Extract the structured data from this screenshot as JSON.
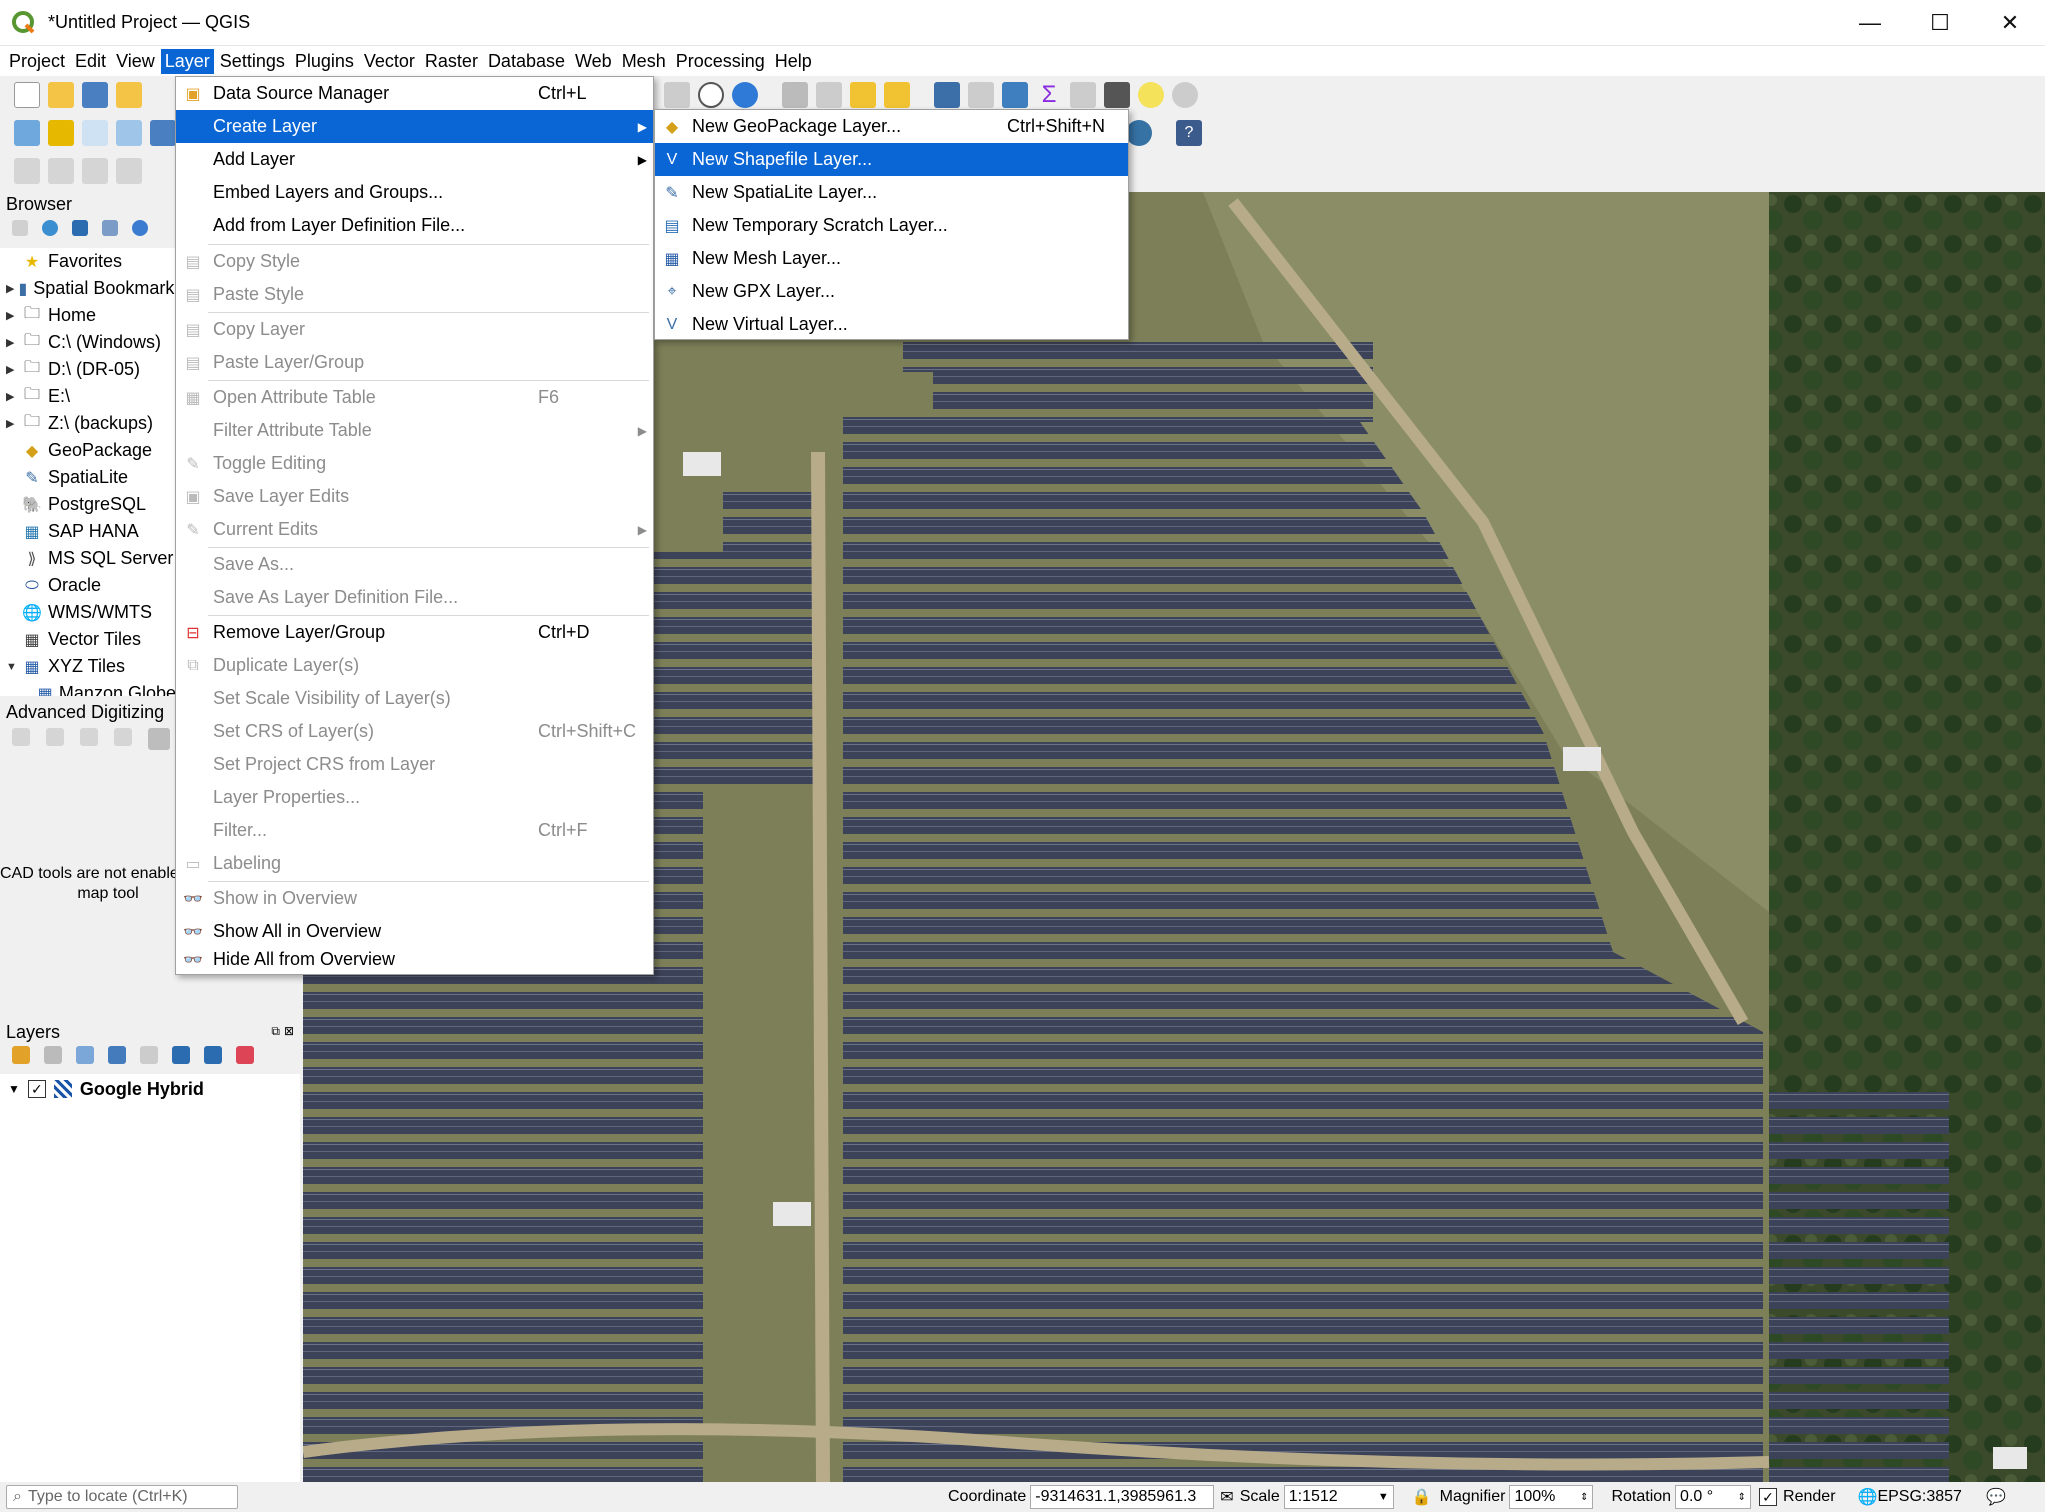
{
  "window": {
    "title": "*Untitled Project — QGIS",
    "minimize": "—",
    "maximize": "☐",
    "close": "✕"
  },
  "menubar": [
    {
      "label": "Project"
    },
    {
      "label": "Edit"
    },
    {
      "label": "View"
    },
    {
      "label": "Layer"
    },
    {
      "label": "Settings"
    },
    {
      "label": "Plugins"
    },
    {
      "label": "Vector"
    },
    {
      "label": "Raster"
    },
    {
      "label": "Database"
    },
    {
      "label": "Web"
    },
    {
      "label": "Mesh"
    },
    {
      "label": "Processing"
    },
    {
      "label": "Help"
    }
  ],
  "browser": {
    "title": "Browser",
    "items": [
      {
        "label": "Favorites",
        "icon": "star-icon"
      },
      {
        "label": "Spatial Bookmarks",
        "icon": "bookmark-icon"
      },
      {
        "label": "Home",
        "icon": "folder-icon"
      },
      {
        "label": "C:\\ (Windows)",
        "icon": "folder-icon"
      },
      {
        "label": "D:\\ (DR-05)",
        "icon": "folder-icon"
      },
      {
        "label": "E:\\",
        "icon": "folder-icon"
      },
      {
        "label": "Z:\\ (backups)",
        "icon": "folder-icon"
      },
      {
        "label": "GeoPackage",
        "icon": "geopackage-icon"
      },
      {
        "label": "SpatiaLite",
        "icon": "spatialite-icon"
      },
      {
        "label": "PostgreSQL",
        "icon": "postgresql-icon"
      },
      {
        "label": "SAP HANA",
        "icon": "sap-hana-icon"
      },
      {
        "label": "MS SQL Server",
        "icon": "mssql-icon"
      },
      {
        "label": "Oracle",
        "icon": "oracle-icon"
      },
      {
        "label": "WMS/WMTS",
        "icon": "globe-icon"
      },
      {
        "label": "Vector Tiles",
        "icon": "grid-icon"
      },
      {
        "label": "XYZ Tiles",
        "icon": "grid-icon"
      },
      {
        "label": "Manzon Globe",
        "icon": "grid-icon"
      }
    ]
  },
  "advanced_digitizing": {
    "title": "Advanced Digitizing",
    "message_line1": "CAD tools are not enabled",
    "message_line2": "map tool"
  },
  "layers": {
    "title": "Layers",
    "items": [
      {
        "label": "Google Hybrid",
        "checked": true
      }
    ]
  },
  "layer_menu": {
    "items": [
      {
        "label": "Data Source Manager",
        "shortcut": "Ctrl+L",
        "disabled": false
      },
      {
        "label": "Create Layer",
        "shortcut": "",
        "disabled": false,
        "submenu": true,
        "highlighted": true
      },
      {
        "label": "Add Layer",
        "shortcut": "",
        "disabled": false,
        "submenu": true
      },
      {
        "label": "Embed Layers and Groups...",
        "shortcut": "",
        "disabled": false
      },
      {
        "label": "Add from Layer Definition File...",
        "shortcut": "",
        "disabled": false
      },
      {
        "label": "Copy Style",
        "shortcut": "",
        "disabled": true
      },
      {
        "label": "Paste Style",
        "shortcut": "",
        "disabled": true
      },
      {
        "label": "Copy Layer",
        "shortcut": "",
        "disabled": true
      },
      {
        "label": "Paste Layer/Group",
        "shortcut": "",
        "disabled": true
      },
      {
        "label": "Open Attribute Table",
        "shortcut": "F6",
        "disabled": true
      },
      {
        "label": "Filter Attribute Table",
        "shortcut": "",
        "disabled": true,
        "submenu": true
      },
      {
        "label": "Toggle Editing",
        "shortcut": "",
        "disabled": true
      },
      {
        "label": "Save Layer Edits",
        "shortcut": "",
        "disabled": true
      },
      {
        "label": "Current Edits",
        "shortcut": "",
        "disabled": true,
        "submenu": true
      },
      {
        "label": "Save As...",
        "shortcut": "",
        "disabled": true
      },
      {
        "label": "Save As Layer Definition File...",
        "shortcut": "",
        "disabled": true
      },
      {
        "label": "Remove Layer/Group",
        "shortcut": "Ctrl+D",
        "disabled": false
      },
      {
        "label": "Duplicate Layer(s)",
        "shortcut": "",
        "disabled": true
      },
      {
        "label": "Set Scale Visibility of Layer(s)",
        "shortcut": "",
        "disabled": true
      },
      {
        "label": "Set CRS of Layer(s)",
        "shortcut": "Ctrl+Shift+C",
        "disabled": true
      },
      {
        "label": "Set Project CRS from Layer",
        "shortcut": "",
        "disabled": true
      },
      {
        "label": "Layer Properties...",
        "shortcut": "",
        "disabled": true
      },
      {
        "label": "Filter...",
        "shortcut": "Ctrl+F",
        "disabled": true
      },
      {
        "label": "Labeling",
        "shortcut": "",
        "disabled": true
      },
      {
        "label": "Show in Overview",
        "shortcut": "",
        "disabled": true
      },
      {
        "label": "Show All in Overview",
        "shortcut": "",
        "disabled": false
      },
      {
        "label": "Hide All from Overview",
        "shortcut": "",
        "disabled": false
      }
    ]
  },
  "create_layer_submenu": {
    "items": [
      {
        "label": "New GeoPackage Layer...",
        "shortcut": "Ctrl+Shift+N"
      },
      {
        "label": "New Shapefile Layer...",
        "shortcut": "",
        "highlighted": true
      },
      {
        "label": "New SpatiaLite Layer...",
        "shortcut": ""
      },
      {
        "label": "New Temporary Scratch Layer...",
        "shortcut": ""
      },
      {
        "label": "New Mesh Layer...",
        "shortcut": ""
      },
      {
        "label": "New GPX Layer...",
        "shortcut": ""
      },
      {
        "label": "New Virtual Layer...",
        "shortcut": ""
      }
    ]
  },
  "statusbar": {
    "locate_placeholder": "Type to locate (Ctrl+K)",
    "coordinate_label": "Coordinate",
    "coordinate_value": "-9314631.1,3985961.3",
    "scale_label": "Scale",
    "scale_value": "1:1512",
    "magnifier_label": "Magnifier",
    "magnifier_value": "100%",
    "rotation_label": "Rotation",
    "rotation_value": "0.0 °",
    "render_label": "Render",
    "crs": "EPSG:3857"
  },
  "colors": {
    "accent": "#0a66d4",
    "disabled_text": "#8c8c8c",
    "qgis_green": "#589632"
  }
}
